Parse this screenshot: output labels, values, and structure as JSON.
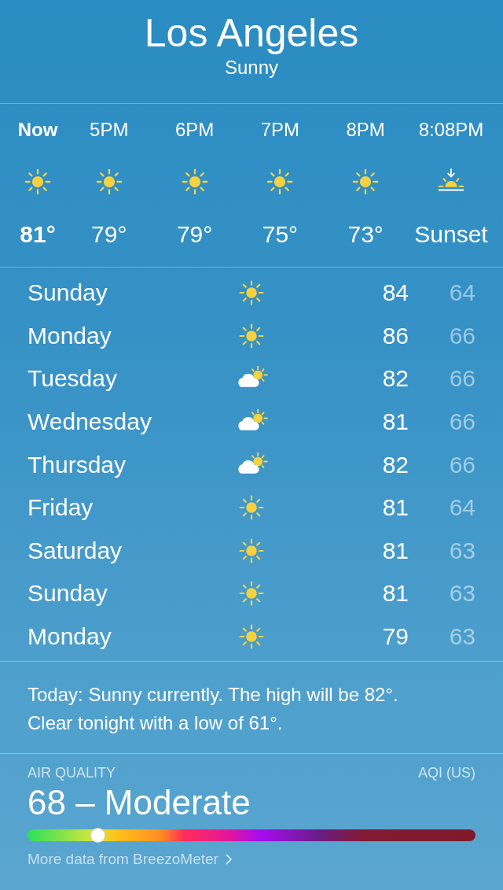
{
  "location": {
    "city": "Los Angeles",
    "condition": "Sunny"
  },
  "hourly": [
    {
      "time": "Now",
      "kind": "sun",
      "temp": "81°",
      "selected": true
    },
    {
      "time": "5PM",
      "kind": "sun",
      "temp": "79°",
      "selected": false
    },
    {
      "time": "6PM",
      "kind": "sun",
      "temp": "79°",
      "selected": false
    },
    {
      "time": "7PM",
      "kind": "sun",
      "temp": "75°",
      "selected": false
    },
    {
      "time": "8PM",
      "kind": "sun",
      "temp": "73°",
      "selected": false
    },
    {
      "time": "8:08PM",
      "kind": "sunset",
      "temp": "Sunset",
      "selected": false
    }
  ],
  "daily": [
    {
      "day": "Sunday",
      "kind": "sun",
      "high": "84",
      "low": "64"
    },
    {
      "day": "Monday",
      "kind": "sun",
      "high": "86",
      "low": "66"
    },
    {
      "day": "Tuesday",
      "kind": "cloud",
      "high": "82",
      "low": "66"
    },
    {
      "day": "Wednesday",
      "kind": "cloud",
      "high": "81",
      "low": "66"
    },
    {
      "day": "Thursday",
      "kind": "cloud",
      "high": "82",
      "low": "66"
    },
    {
      "day": "Friday",
      "kind": "sun",
      "high": "81",
      "low": "64"
    },
    {
      "day": "Saturday",
      "kind": "sun",
      "high": "81",
      "low": "63"
    },
    {
      "day": "Sunday",
      "kind": "sun",
      "high": "81",
      "low": "63"
    },
    {
      "day": "Monday",
      "kind": "sun",
      "high": "79",
      "low": "63"
    }
  ],
  "summary": "Today: Sunny currently. The high will be 82°. Clear tonight with a low of 61°.",
  "air_quality": {
    "label": "AIR QUALITY",
    "scale": "AQI (US)",
    "value": "68 – Moderate",
    "level": 0.156,
    "link": "More data from BreezoMeter"
  }
}
